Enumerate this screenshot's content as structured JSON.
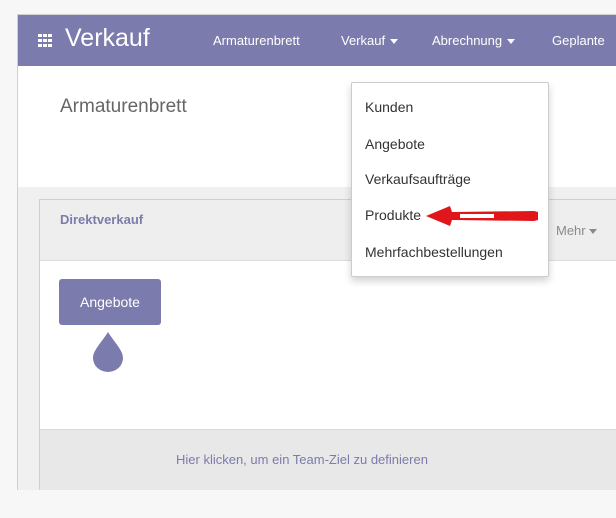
{
  "app": {
    "title": "Verkauf"
  },
  "nav": {
    "items": [
      {
        "label": "Armaturenbrett"
      },
      {
        "label": "Verkauf",
        "has_caret": true
      },
      {
        "label": "Abrechnung",
        "has_caret": true
      },
      {
        "label": "Geplante"
      }
    ]
  },
  "breadcrumb": {
    "label": "Armaturenbrett"
  },
  "dropdown": {
    "items": [
      {
        "label": "Kunden"
      },
      {
        "label": "Angebote"
      },
      {
        "label": "Verkaufsaufträge"
      },
      {
        "label": "Produkte",
        "highlighted": true
      },
      {
        "label": "Mehrfachbestellungen"
      }
    ]
  },
  "card": {
    "title": "Direktverkauf",
    "more_label": "Mehr",
    "quotes_button": "Angebote",
    "footer_link": "Hier klicken, um ein Team-Ziel zu definieren"
  },
  "icons": {
    "apps": "grid-icon",
    "drop": "drop-icon",
    "annotation": "red-arrow"
  },
  "colors": {
    "brand": "#7c7bad",
    "annotation": "#e0161b"
  }
}
